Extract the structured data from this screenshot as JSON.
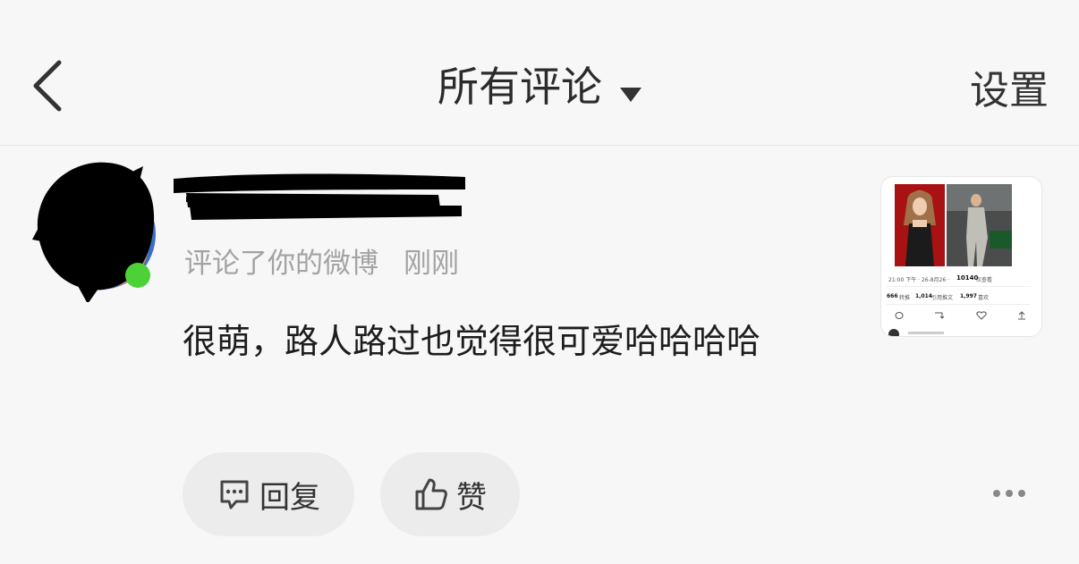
{
  "header": {
    "title": "所有评论",
    "settings_label": "设置"
  },
  "comment": {
    "action": "评论了你的微博",
    "time": "刚刚",
    "text": "很萌，路人路过也觉得很可爱哈哈哈哈"
  },
  "thumbnail": {
    "time_text": "21:00 下午 · 26-8月26 ·",
    "views": "10140",
    "views_label": "次查看",
    "retweets": "666",
    "retweets_label": "转推",
    "quotes": "1,014",
    "quotes_label": "引用推文",
    "likes": "1,997",
    "likes_label": "喜欢"
  },
  "actions": {
    "reply_label": "回复",
    "like_label": "赞"
  },
  "colors": {
    "background": "#f7f7f7",
    "button_bg": "#ececec",
    "meta_text": "#a3a3a3",
    "online_dot": "#4cd137"
  }
}
